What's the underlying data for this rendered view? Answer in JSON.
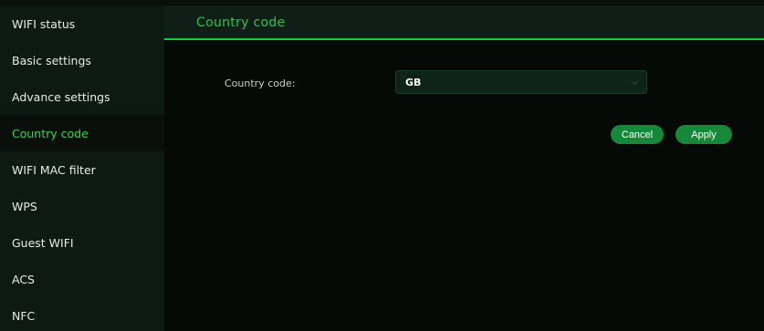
{
  "sidebar": {
    "items": [
      {
        "label": "WIFI status",
        "active": false
      },
      {
        "label": "Basic settings",
        "active": false
      },
      {
        "label": "Advance settings",
        "active": false
      },
      {
        "label": "Country code",
        "active": true
      },
      {
        "label": "WIFI MAC filter",
        "active": false
      },
      {
        "label": "WPS",
        "active": false
      },
      {
        "label": "Guest WIFI",
        "active": false
      },
      {
        "label": "ACS",
        "active": false
      },
      {
        "label": "NFC",
        "active": false
      }
    ]
  },
  "panel": {
    "title": "Country code",
    "field_label": "Country code:",
    "country_value": "GB"
  },
  "actions": {
    "cancel_label": "Cancel",
    "apply_label": "Apply"
  },
  "colors": {
    "accent": "#2ed84a",
    "button": "#17883a",
    "sidebar_bg": "#0d1a14",
    "main_bg": "#050a07"
  }
}
